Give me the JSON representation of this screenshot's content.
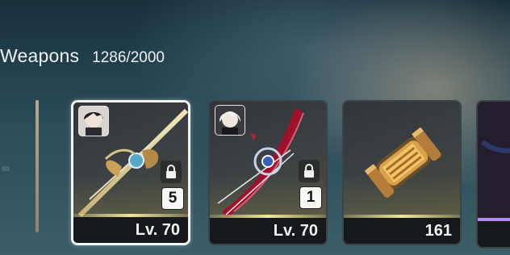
{
  "header": {
    "title": "Weapons",
    "count": "1286/2000"
  },
  "cards": [
    {
      "name": "weapon-card-1",
      "item_icon": "golden-spear-icon",
      "character_icon": "dark-haired-character-avatar",
      "locked": true,
      "quantity_badge": "5",
      "level_label": "Lv. 70",
      "selected": true,
      "rarity_color": "#efe59a"
    },
    {
      "name": "weapon-card-2",
      "item_icon": "crimson-bow-icon",
      "character_icon": "white-haired-character-avatar",
      "locked": true,
      "quantity_badge": "1",
      "level_label": "Lv. 70",
      "selected": false,
      "rarity_color": "#efe59a"
    },
    {
      "name": "material-card",
      "item_icon": "brass-capsule-icon",
      "footer_value": "161",
      "selected": false,
      "rarity_color": "#efe59a"
    },
    {
      "name": "partial-card",
      "rarity_color": "#b48cf0"
    }
  ]
}
